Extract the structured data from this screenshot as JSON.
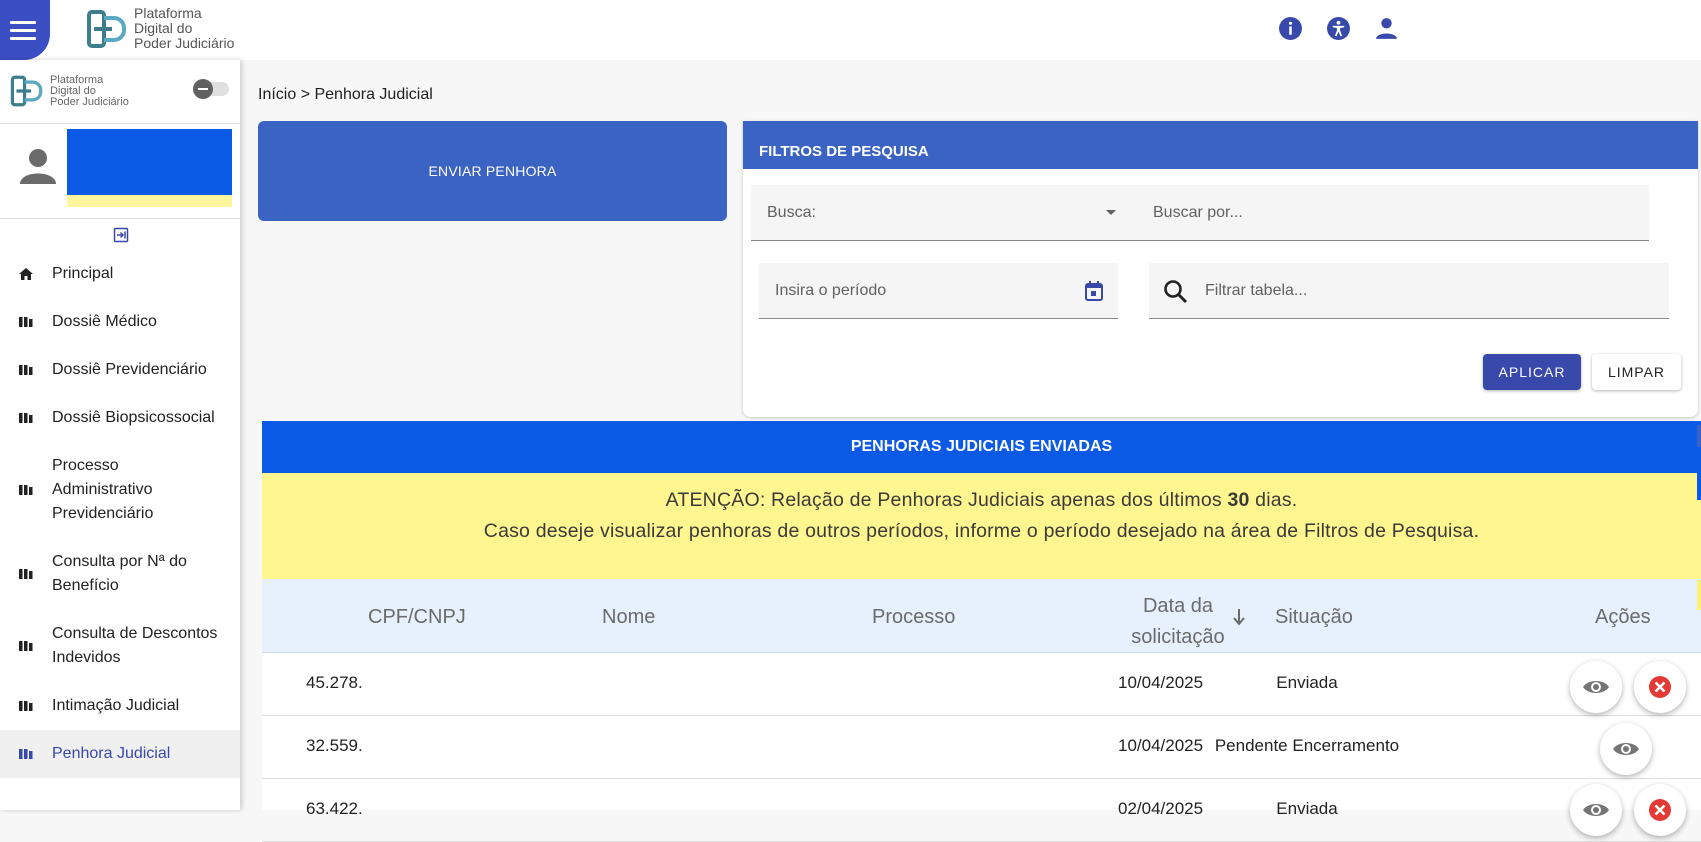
{
  "header": {
    "logo_text": [
      "Plataforma",
      "Digital do",
      "Poder Judiciário"
    ],
    "icons": [
      "info-icon",
      "accessibility-icon",
      "user-icon"
    ]
  },
  "sidebar": {
    "logo_text": [
      "Plataforma",
      "Digital do",
      "Poder Judiciário"
    ],
    "items": [
      {
        "label": "Principal",
        "icon": "home-icon"
      },
      {
        "label": "Dossiê Médico",
        "icon": "menu-book-icon"
      },
      {
        "label": "Dossiê Previdenciário",
        "icon": "menu-book-icon"
      },
      {
        "label": "Dossiê Biopsicossocial",
        "icon": "menu-book-icon"
      },
      {
        "label": "Processo Administrativo Previdenciário",
        "icon": "menu-book-icon"
      },
      {
        "label": "Consulta por Nª do Benefício",
        "icon": "menu-book-icon"
      },
      {
        "label": "Consulta de Descontos Indevidos",
        "icon": "menu-book-icon"
      },
      {
        "label": "Intimação Judicial",
        "icon": "menu-book-icon"
      },
      {
        "label": "Penhora Judicial",
        "icon": "menu-book-icon",
        "active": true
      }
    ]
  },
  "breadcrumb": "Início > Penhora Judicial",
  "send_button": "ENVIAR PENHORA",
  "filters": {
    "title": "FILTROS DE PESQUISA",
    "busca_label": "Busca:",
    "buscar_por_placeholder": "Buscar por...",
    "periodo_placeholder": "Insira o período",
    "filtrar_placeholder": "Filtrar tabela...",
    "apply": "APLICAR",
    "clear": "LIMPAR"
  },
  "table": {
    "title": "PENHORAS JUDICIAIS ENVIADAS",
    "attention_line1_pre": "ATENÇÃO: Relação de Penhoras Judiciais apenas dos últimos ",
    "attention_line1_bold": "30",
    "attention_line1_post": " dias.",
    "attention_line2": "Caso deseje visualizar penhoras de outros períodos, informe o período desejado na área de Filtros de Pesquisa.",
    "columns": {
      "cpf": "CPF/CNPJ",
      "nome": "Nome",
      "processo": "Processo",
      "data_l1": "Data da",
      "data_l2": "solicitação",
      "situacao": "Situação",
      "acoes": "Ações"
    },
    "rows": [
      {
        "cpf": "45.278.",
        "data": "10/04/2025",
        "situacao": "Enviada",
        "actions": [
          "view",
          "cancel"
        ]
      },
      {
        "cpf": "32.559.",
        "data": "10/04/2025",
        "situacao": "Pendente Encerramento",
        "actions": [
          "view"
        ]
      },
      {
        "cpf": "63.422.",
        "data": "02/04/2025",
        "situacao": "Enviada",
        "actions": [
          "view",
          "cancel"
        ]
      }
    ]
  },
  "colors": {
    "primary": "#3b63c4",
    "table_header": "#0b5ae6",
    "attention": "#fff68f",
    "accent": "#3949ab",
    "cancel": "#e53935"
  }
}
